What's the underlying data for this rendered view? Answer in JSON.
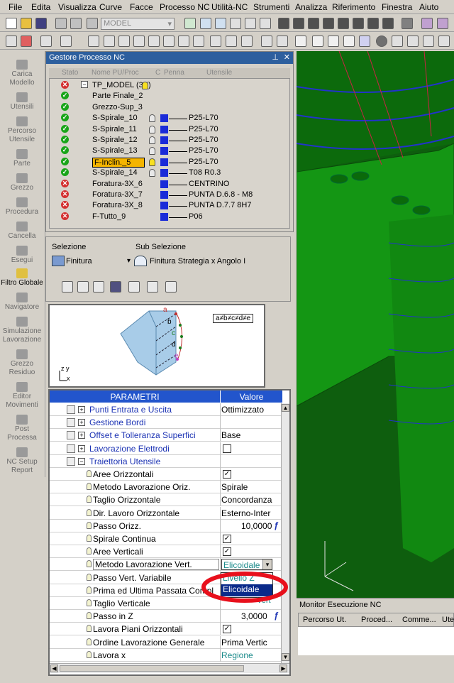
{
  "menubar": {
    "items": [
      "File",
      "Edita",
      "Visualizza",
      "Curve",
      "Facce",
      "Processo NC",
      "Utilità-NC",
      "Strumenti",
      "Analizza",
      "Riferimento",
      "Finestra",
      "Aiuto"
    ]
  },
  "toolbar": {
    "model_combo": "MODEL"
  },
  "leftbar": {
    "items": [
      "Carica Modello",
      "Utensili",
      "Percorso Utensile",
      "Parte",
      "Grezzo",
      "Procedura",
      "Cancella",
      "Esegui",
      "Filtro Globale",
      "Navigatore",
      "Simulazione Lavorazione",
      "Grezzo Residuo",
      "Editor Movimenti",
      "Post Processa",
      "NC Setup Report"
    ]
  },
  "gestore": {
    "title": "Gestore Processo NC",
    "columns": [
      "Stato",
      "Nome PU/Proc",
      "C",
      "Penna",
      "Utensile"
    ],
    "rows": [
      {
        "status": "err",
        "name": "TP_MODEL (3X)",
        "tool": ""
      },
      {
        "status": "ok",
        "name": "Parte Finale_2",
        "tool": ""
      },
      {
        "status": "ok",
        "name": "Grezzo-Sup_3",
        "tool": ""
      },
      {
        "status": "ok",
        "name": "S-Spirale_10",
        "tool": "P25-L70"
      },
      {
        "status": "ok",
        "name": "S-Spirale_11",
        "tool": "P25-L70"
      },
      {
        "status": "ok",
        "name": "S-Spirale_12",
        "tool": "P25-L70"
      },
      {
        "status": "ok",
        "name": "S-Spirale_13",
        "tool": "P25-L70"
      },
      {
        "status": "ok",
        "name": "F-Inclin._5",
        "tool": "P25-L70"
      },
      {
        "status": "ok",
        "name": "S-Spirale_14",
        "tool": "T08 R0.3"
      },
      {
        "status": "err",
        "name": "Foratura-3X_6",
        "tool": "CENTRINO"
      },
      {
        "status": "err",
        "name": "Foratura-3X_7",
        "tool": "PUNTA D.6.8 - M8"
      },
      {
        "status": "err",
        "name": "Foratura-3X_8",
        "tool": "PUNTA D.7.7  8H7"
      },
      {
        "status": "err",
        "name": "F-Tutto_9",
        "tool": "P06"
      }
    ]
  },
  "selezione": {
    "label": "Selezione",
    "value": "Finitura",
    "sub_label": "Sub Selezione",
    "sub_value": "Finitura Strategia x Angolo I"
  },
  "preview": {
    "legend": "a≠b≠c≠d≠e",
    "labels": [
      "a",
      "b",
      "c",
      "d",
      "e"
    ]
  },
  "params": {
    "header_name": "PARAMETRI",
    "header_value": "Valore",
    "rows": [
      {
        "name": "Punti Entrata e Uscita",
        "value": "Ottimizzato",
        "kind": "group"
      },
      {
        "name": "Gestione Bordi",
        "value": "",
        "kind": "group"
      },
      {
        "name": "Offset e Tolleranza Superfici",
        "value": "Base",
        "kind": "group"
      },
      {
        "name": "Lavorazione Elettrodi",
        "value": "",
        "kind": "group-check"
      },
      {
        "name": "Traiettoria Utensile",
        "value": "",
        "kind": "group-open"
      },
      {
        "name": "Aree Orizzontali",
        "value": "✓",
        "kind": "check"
      },
      {
        "name": "Metodo Lavorazione Oriz.",
        "value": "Spirale",
        "kind": "text"
      },
      {
        "name": "Taglio Orizzontale",
        "value": "Concordanza",
        "kind": "text"
      },
      {
        "name": "Dir. Lavoro Orizzontale",
        "value": "Esterno-Inter",
        "kind": "text"
      },
      {
        "name": "Passo Orizz.",
        "value": "10,0000",
        "kind": "num"
      },
      {
        "name": "Spirale Continua",
        "value": "✓",
        "kind": "check"
      },
      {
        "name": "Aree Verticali",
        "value": "✓",
        "kind": "check"
      },
      {
        "name": "Metodo Lavorazione Vert.",
        "value": "Elicoidale",
        "kind": "combo"
      },
      {
        "name": "Passo Vert. Variabile",
        "value": "",
        "kind": "text"
      },
      {
        "name": "Prima ed Ultima Passata Compl",
        "value": "",
        "kind": "text"
      },
      {
        "name": "Taglio Verticale",
        "value": "",
        "kind": "text"
      },
      {
        "name": "Passo in Z",
        "value": "3,0000",
        "kind": "num"
      },
      {
        "name": "Lavora Piani Orizzontali",
        "value": "✓",
        "kind": "check"
      },
      {
        "name": "Ordine Lavorazione Generale",
        "value": "Prima Vertic",
        "kind": "text"
      },
      {
        "name": "Lavora x",
        "value": "Regione",
        "kind": "teal"
      }
    ],
    "dropdown_options": [
      "Livello Z",
      "Elicoidale"
    ],
    "dropdown_trailing": "Vert"
  },
  "monitor": {
    "title": "Monitor Esecuzione NC",
    "columns": [
      "Percorso Ut.",
      "Proced...",
      "Comme...",
      "Ute"
    ]
  },
  "colors": {
    "highlight_ring": "#e8101c",
    "title_blue": "#2d5f9e",
    "param_header": "#2255cc"
  }
}
